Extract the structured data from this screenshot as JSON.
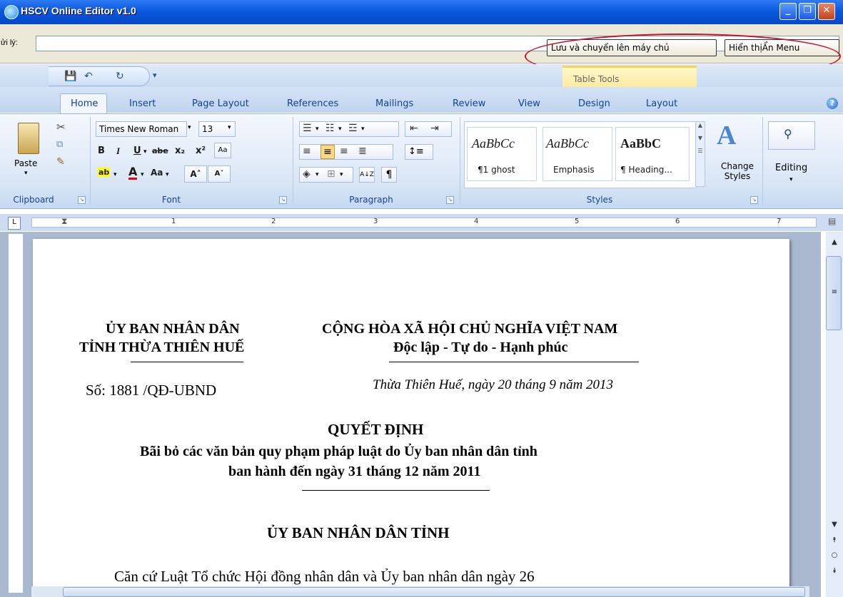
{
  "window": {
    "title": "HSCV Online Editor v1.0",
    "minimize": "_",
    "maximize": "❐",
    "close": "✕"
  },
  "toolbar": {
    "path_label": "ửi lý:",
    "path_value": "",
    "save_upload_button": "Lưu và chuyển lên máy chủ",
    "toggle_menu_button": "Hiển thịẨn Menu"
  },
  "ribbon": {
    "contextual_label": "Table Tools",
    "tabs": [
      "Home",
      "Insert",
      "Page Layout",
      "References",
      "Mailings",
      "Review",
      "View",
      "Design",
      "Layout"
    ],
    "active_tab": "Home",
    "clipboard": {
      "paste_label": "Paste",
      "group_label": "Clipboard"
    },
    "font": {
      "font_name": "Times New Roman",
      "font_size": "13",
      "bold": "B",
      "italic": "I",
      "underline": "U",
      "strike": "abe",
      "subscript": "x₂",
      "superscript": "x²",
      "highlight": "ab",
      "font_color": "A",
      "change_case": "Aa",
      "grow": "A˄",
      "shrink": "A˅",
      "group_label": "Font"
    },
    "paragraph": {
      "group_label": "Paragraph",
      "pilcrow": "¶",
      "sort": "A↓Z"
    },
    "styles": {
      "items": [
        {
          "sample": "AaBbCc",
          "name": "¶1 ghost"
        },
        {
          "sample": "AaBbCc",
          "name": "Emphasis"
        },
        {
          "sample": "AaBbC",
          "name": "¶ Heading..."
        }
      ],
      "change_styles_label": "Change Styles",
      "group_label": "Styles"
    },
    "editing": {
      "label": "Editing"
    }
  },
  "ruler": {
    "numbers": [
      "1",
      "2",
      "3",
      "4",
      "5",
      "6",
      "7"
    ],
    "tab_marker": "L"
  },
  "document": {
    "left_header_1": "ỦY BAN NHÂN DÂN",
    "left_header_2": "TỈNH THỪA THIÊN HUẾ",
    "right_header_1": "CỘNG HÒA XÃ HỘI CHỦ NGHĨA VIỆT NAM",
    "right_header_2": "Độc lập - Tự do - Hạnh phúc",
    "number_line": "Số:   1881   /QĐ-UBND",
    "date_line": "Thừa Thiên Huế, ngày  20  tháng 9 năm 2013",
    "decision_title": "QUYẾT ĐỊNH",
    "subject_1": "Bãi bỏ các văn bản quy phạm pháp luật do Ủy ban nhân dân tỉnh",
    "subject_2": "ban hành đến ngày 31 tháng 12 năm 2011",
    "authority": "ỦY BAN NHÂN DÂN TỈNH",
    "body_1": "Căn cứ Luật Tổ chức Hội đồng nhân dân và Ủy ban nhân dân ngày 26"
  }
}
